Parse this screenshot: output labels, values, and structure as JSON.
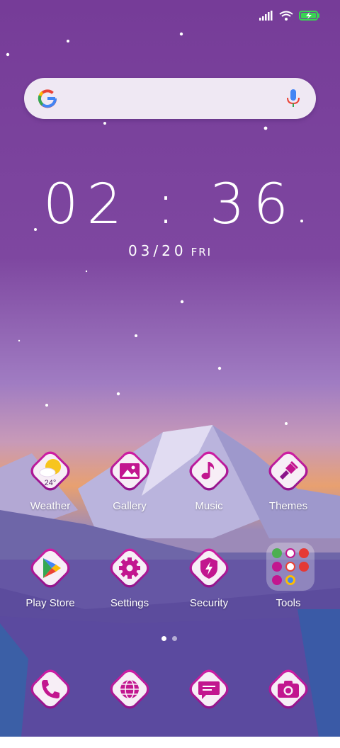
{
  "status": {
    "signal_icon": "signal-icon",
    "wifi_icon": "wifi-icon",
    "battery_icon": "battery-charging-icon",
    "battery_color": "#39d353"
  },
  "search": {
    "google_icon": "google-g-icon",
    "mic_icon": "mic-icon"
  },
  "clock": {
    "time": "02 : 36",
    "date": "03/20",
    "weekday": "FRI"
  },
  "colors": {
    "accent": "#c2168f",
    "tile": "#f7eef6",
    "sky_top": "#763c98"
  },
  "apps": [
    {
      "label": "Weather",
      "icon": "weather-icon",
      "temp": "24°"
    },
    {
      "label": "Gallery",
      "icon": "gallery-icon"
    },
    {
      "label": "Music",
      "icon": "music-note-icon"
    },
    {
      "label": "Themes",
      "icon": "paintbrush-icon"
    },
    {
      "label": "Play Store",
      "icon": "play-store-icon"
    },
    {
      "label": "Settings",
      "icon": "gear-icon"
    },
    {
      "label": "Security",
      "icon": "shield-icon"
    },
    {
      "label": "Tools",
      "icon": "folder-icon"
    }
  ],
  "dock": [
    {
      "icon": "phone-icon"
    },
    {
      "icon": "browser-globe-icon"
    },
    {
      "icon": "messages-icon"
    },
    {
      "icon": "camera-icon"
    }
  ],
  "pager": {
    "pages": 2,
    "current": 1
  }
}
